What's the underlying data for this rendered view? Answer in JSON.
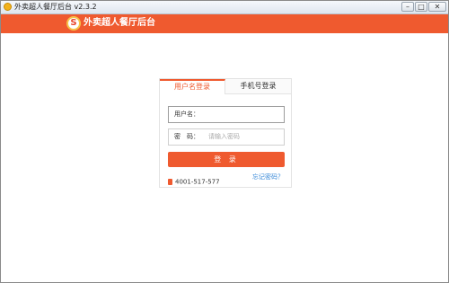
{
  "window": {
    "title": "外卖超人餐厅后台 v2.3.2",
    "controls": {
      "minimize": "–",
      "maximize": "□",
      "close": "✕"
    }
  },
  "header": {
    "logo_letter": "S",
    "title": "外卖超人餐厅后台"
  },
  "login": {
    "tabs": [
      {
        "label": "用户名登录",
        "active": true
      },
      {
        "label": "手机号登录",
        "active": false
      }
    ],
    "username": {
      "label": "用户名：",
      "value": ""
    },
    "password": {
      "label": "密　码：",
      "placeholder": "请输入密码"
    },
    "submit_label": "登 录",
    "phone": "4001-517-577",
    "forgot_label": "忘记密码？"
  },
  "colors": {
    "brand": "#ef5a2f",
    "link": "#3a8ad8"
  }
}
